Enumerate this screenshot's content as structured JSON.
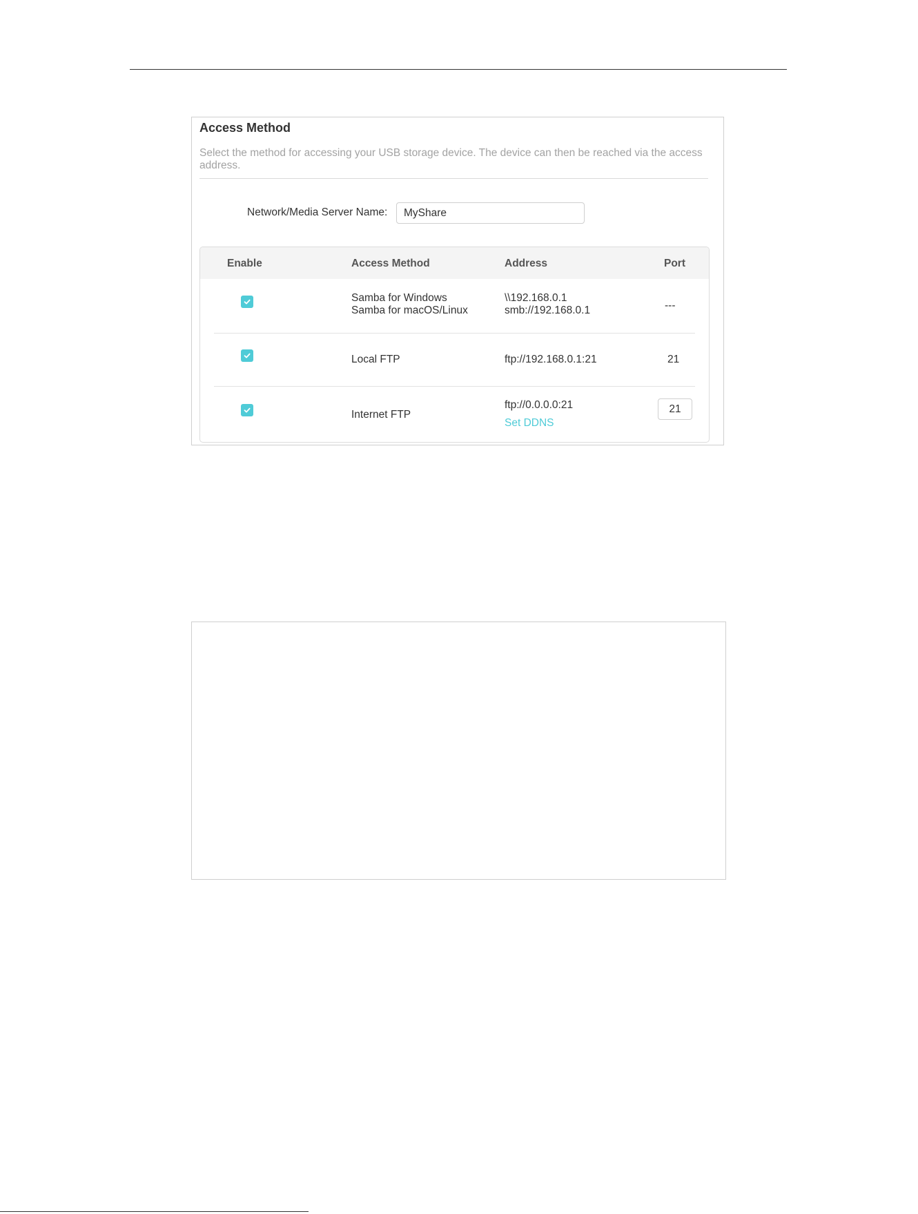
{
  "panel": {
    "title": "Access Method",
    "description": "Select the method for accessing your USB storage device. The device can then be reached via the access address.",
    "server_name_label": "Network/Media Server Name:",
    "server_name_value": "MyShare"
  },
  "table": {
    "headers": {
      "enable": "Enable",
      "access_method": "Access Method",
      "address": "Address",
      "port": "Port"
    },
    "rows": [
      {
        "enabled": true,
        "method_line1": "Samba for Windows",
        "method_line2": "Samba for macOS/Linux",
        "address_line1": "\\\\192.168.0.1",
        "address_line2": "smb://192.168.0.1",
        "port": "---"
      },
      {
        "enabled": true,
        "method": "Local FTP",
        "address": "ftp://192.168.0.1:21",
        "port": "21"
      },
      {
        "enabled": true,
        "method": "Internet FTP",
        "address": "ftp://0.0.0.0:21",
        "link": "Set DDNS",
        "port": "21"
      }
    ]
  },
  "colors": {
    "accent": "#4fcbd7",
    "header_bg": "#f4f4f4",
    "muted_text": "#a3a3a3"
  },
  "icons": {
    "checkbox": "checkmark-icon"
  }
}
